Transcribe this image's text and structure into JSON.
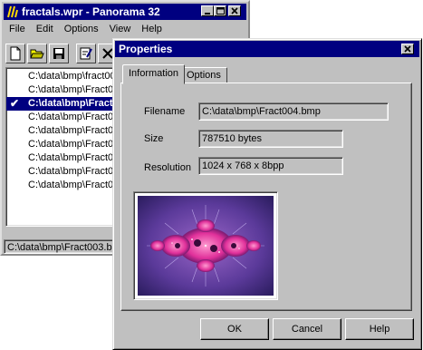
{
  "back_window": {
    "title": "fractals.wpr - Panorama 32",
    "buttons": {
      "minimize": "_",
      "maximize": "□",
      "close": "×"
    },
    "menu": [
      "File",
      "Edit",
      "Options",
      "View",
      "Help"
    ],
    "toolbar": [
      "new-file-icon",
      "open-folder-icon",
      "save-icon",
      "edit-properties-icon",
      "close-icon"
    ],
    "files": [
      {
        "path": "C:\\data\\bmp\\fract001",
        "selected": false
      },
      {
        "path": "C:\\data\\bmp\\Fract00",
        "selected": false
      },
      {
        "path": "C:\\data\\bmp\\Fract",
        "selected": true
      },
      {
        "path": "C:\\data\\bmp\\Fract00",
        "selected": false
      },
      {
        "path": "C:\\data\\bmp\\Fract00",
        "selected": false
      },
      {
        "path": "C:\\data\\bmp\\Fract00",
        "selected": false
      },
      {
        "path": "C:\\data\\bmp\\Fract00",
        "selected": false
      },
      {
        "path": "C:\\data\\bmp\\Fract00",
        "selected": false
      },
      {
        "path": "C:\\data\\bmp\\Fract01",
        "selected": false
      }
    ],
    "status": "C:\\data\\bmp\\Fract003.b"
  },
  "dialog": {
    "title": "Properties",
    "tabs": [
      "Information",
      "Options"
    ],
    "active_tab": "Information",
    "fields": {
      "filename_label": "Filename",
      "filename_value": "C:\\data\\bmp\\Fract004.bmp",
      "size_label": "Size",
      "size_value": "787510 bytes",
      "resolution_label": "Resolution",
      "resolution_value": "1024 x 768 x 8bpp"
    },
    "buttons": {
      "ok": "OK",
      "cancel": "Cancel",
      "help": "Help"
    }
  },
  "colors": {
    "titlebar": "#000080",
    "face": "#c0c0c0",
    "selection": "#000080"
  }
}
